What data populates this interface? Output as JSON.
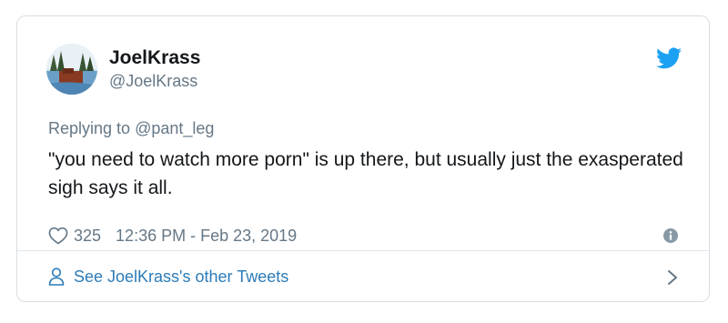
{
  "user": {
    "display_name": "JoelKrass",
    "handle": "@JoelKrass"
  },
  "reply": {
    "prefix": "Replying to ",
    "to_handle": "@pant_leg"
  },
  "tweet": {
    "text": "\"you need to watch more porn\" is up there, but usually just the exasperated sigh says it all."
  },
  "meta": {
    "like_count": "325",
    "timestamp": "12:36 PM - Feb 23, 2019"
  },
  "footer": {
    "link_text": "See JoelKrass's other Tweets"
  },
  "icons": {
    "brand": "twitter-bird-icon",
    "like": "heart-icon",
    "info": "info-icon",
    "footer": "person-icon",
    "chevron": "chevron-right-icon"
  },
  "colors": {
    "twitter_blue": "#1da1f2",
    "link_blue": "#2b7bb9",
    "secondary_text": "#657786",
    "primary_text": "#14171a"
  }
}
